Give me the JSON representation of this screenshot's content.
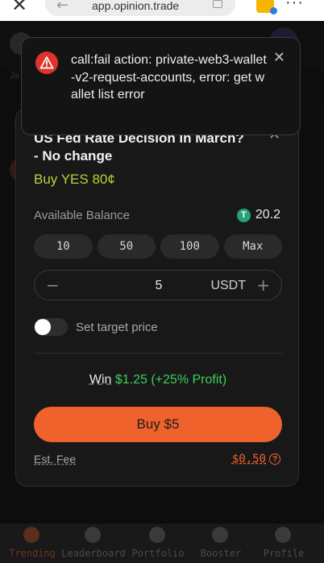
{
  "browser": {
    "close_glyph": "✕",
    "back_glyph": "←",
    "url": "app.opinion.trade",
    "more_glyph": "···"
  },
  "background": {
    "partial_text": "Ja"
  },
  "toast": {
    "message": "call:fail action: private-web3-wallet-v2-request-accounts, error: get wallet list error",
    "close_glyph": "✕"
  },
  "order": {
    "market_title": "US Fed Rate Decision in March? - No change",
    "close_glyph": "✕",
    "side": "Buy YES 80¢",
    "balance_label": "Available Balance",
    "balance_value": "20.2",
    "tether_glyph": "T",
    "quick_amounts": [
      "10",
      "50",
      "100",
      "Max"
    ],
    "quantity": "5",
    "unit": "USDT",
    "minus_glyph": "−",
    "plus_glyph": "+",
    "target_price_label": "Set target price",
    "target_price_enabled": false,
    "win_label": "Win",
    "win_value": "$1.25 (+25% Profit)",
    "buy_button": "Buy $5",
    "fee_label": "Est. Fee",
    "fee_value": "$0.50",
    "info_glyph": "?"
  },
  "nav": {
    "items": [
      {
        "label": "Trending",
        "active": true
      },
      {
        "label": "Leaderboard",
        "active": false
      },
      {
        "label": "Portfolio",
        "active": false
      },
      {
        "label": "Booster",
        "active": false
      },
      {
        "label": "Profile",
        "active": false
      }
    ]
  },
  "colors": {
    "accent": "#f0622c",
    "yes_green": "#b8d538",
    "profit_green": "#3ecf5a",
    "error_red": "#e0332b",
    "tether_green": "#26a17b"
  }
}
